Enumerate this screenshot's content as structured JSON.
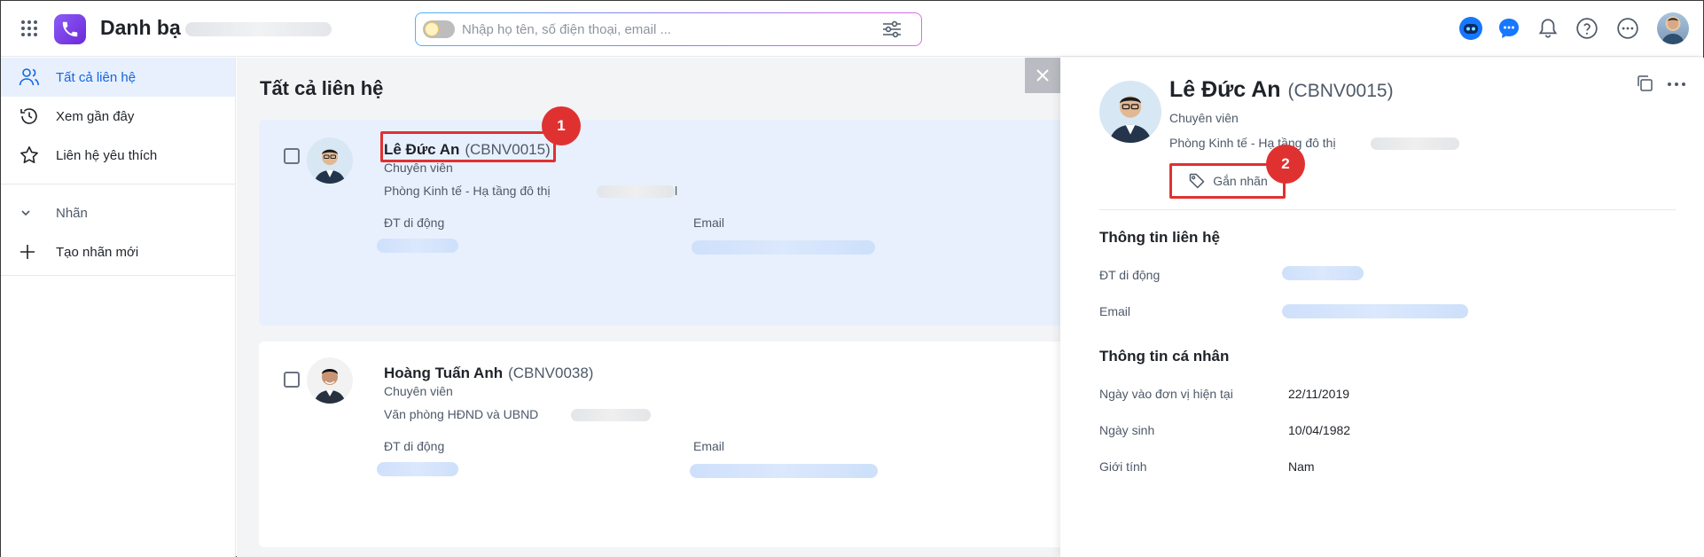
{
  "app": {
    "title": "Danh bạ"
  },
  "search": {
    "placeholder": "Nhập họ tên, số điện thoại, email ..."
  },
  "sidebar": {
    "items": [
      {
        "label": "Tất cả liên hệ",
        "icon": "contacts-icon",
        "active": true
      },
      {
        "label": "Xem gần đây",
        "icon": "history-icon"
      },
      {
        "label": "Liên hệ yêu thích",
        "icon": "star-icon"
      }
    ],
    "labels_group": "Nhãn",
    "new_label": "Tạo nhãn mới"
  },
  "main": {
    "title": "Tất cả liên hệ",
    "contacts": [
      {
        "name": "Lê Đức An",
        "code": "(CBNV0015)",
        "position": "Chuyên viên",
        "department": "Phòng Kinh tế - Hạ tầng đô thị",
        "dept_suffix": "l",
        "mobile_label": "ĐT di động",
        "email_label": "Email",
        "selected": true
      },
      {
        "name": "Hoàng Tuấn Anh",
        "code": "(CBNV0038)",
        "position": "Chuyên viên",
        "department": "Văn phòng HĐND và UBND",
        "mobile_label": "ĐT di động",
        "email_label": "Email"
      }
    ]
  },
  "annotations": {
    "badge1": "1",
    "badge2": "2"
  },
  "detail": {
    "name": "Lê Đức An",
    "code": "(CBNV0015)",
    "position": "Chuyên viên",
    "department": "Phòng Kinh tế - Hạ tầng đô thị",
    "tag_button": "Gắn nhãn",
    "contact_section": "Thông tin liên hệ",
    "mobile_label": "ĐT di động",
    "email_label": "Email",
    "personal_section": "Thông tin cá nhân",
    "join_label": "Ngày vào đơn vị hiện tại",
    "join_value": "22/11/2019",
    "dob_label": "Ngày sinh",
    "dob_value": "10/04/1982",
    "gender_label": "Giới tính",
    "gender_value": "Nam"
  },
  "colors": {
    "accent": "#1366e0",
    "selected_bg": "#e8f0fd",
    "annotation_red": "#e03131",
    "logo_purple": "#7c3aed"
  }
}
